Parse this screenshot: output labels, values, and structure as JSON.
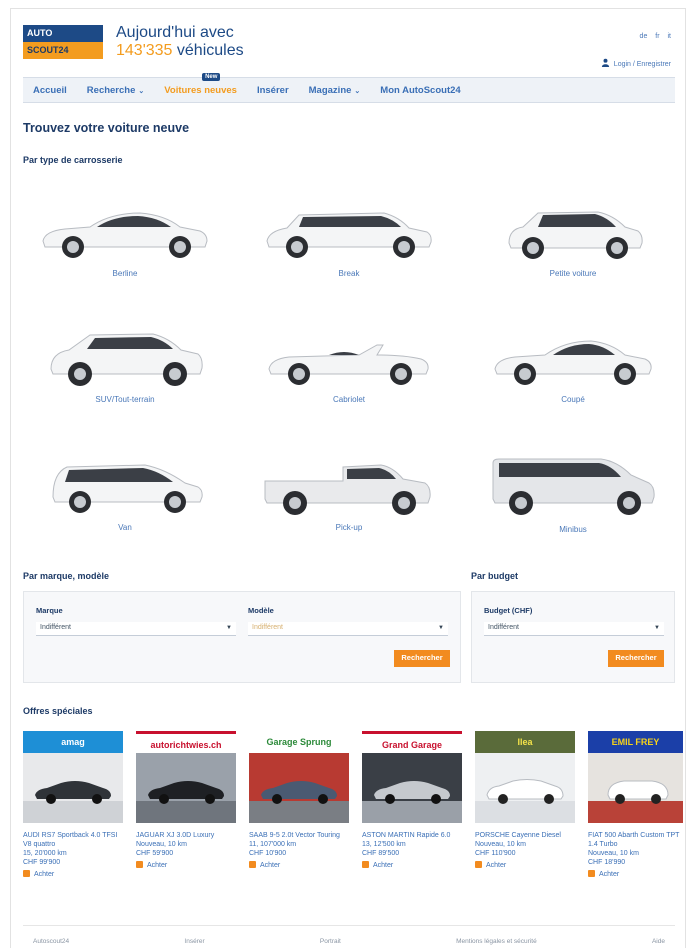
{
  "header": {
    "logo_top": "AUTO",
    "logo_bottom": "SCOUT24",
    "tagline_line1": "Aujourd'hui avec",
    "vehicle_count": "143'335",
    "vehicle_word": "véhicules",
    "languages": "de fr it",
    "login": "Login / Enregistrer"
  },
  "nav": {
    "items": [
      {
        "label": "Accueil"
      },
      {
        "label": "Recherche"
      },
      {
        "label": "Voitures neuves",
        "badge": "New"
      },
      {
        "label": "Insérer"
      },
      {
        "label": "Magazine"
      },
      {
        "label": "Mon AutoScout24"
      }
    ]
  },
  "page_title": "Trouvez votre voiture neuve",
  "body_types": {
    "title": "Par type de carrosserie",
    "items": [
      {
        "label": "Berline"
      },
      {
        "label": "Break"
      },
      {
        "label": "Petite voiture"
      },
      {
        "label": "SUV/Tout-terrain"
      },
      {
        "label": "Cabriolet"
      },
      {
        "label": "Coupé"
      },
      {
        "label": "Van"
      },
      {
        "label": "Pick-up"
      },
      {
        "label": "Minibus"
      }
    ]
  },
  "make_model": {
    "title": "Par marque, modèle",
    "make_label": "Marque",
    "make_value": "Indifférent",
    "model_label": "Modèle",
    "model_value": "Indifférent",
    "button": "Rechercher"
  },
  "budget": {
    "title": "Par budget",
    "label": "Budget (CHF)",
    "value": "Indifférent",
    "button": "Rechercher"
  },
  "offers": {
    "title": "Offres spéciales",
    "items": [
      {
        "brand": "amag",
        "text": "AUDI RS7 Sportback 4.0 TFSI V8 quattro",
        "line2": "15, 20'000 km",
        "line3": "CHF 99'900",
        "action": "Achter"
      },
      {
        "brand": "autorichtwies.ch",
        "text": "JAGUAR XJ 3.0D Luxury",
        "line2": "Nouveau, 10 km",
        "line3": "CHF 59'900",
        "action": "Achter"
      },
      {
        "brand": "Garage Sprung",
        "text": "SAAB 9-5 2.0t Vector Touring",
        "line2": "11, 107'000 km",
        "line3": "CHF 10'900",
        "action": "Achter"
      },
      {
        "brand": "Grand Garage",
        "text": "ASTON MARTIN Rapide 6.0",
        "line2": "13, 12'500 km",
        "line3": "CHF 89'500",
        "action": "Achter"
      },
      {
        "brand": "Ilea",
        "text": "PORSCHE Cayenne Diesel",
        "line2": "Nouveau, 10 km",
        "line3": "CHF 110'900",
        "action": "Achter"
      },
      {
        "brand": "EMIL FREY",
        "text": "FIAT 500 Abarth Custom TPT 1.4 Turbo",
        "line2": "Nouveau, 10 km",
        "line3": "CHF 18'990",
        "action": "Achter"
      }
    ]
  },
  "footer": {
    "links": [
      "Autoscout24",
      "Insérer",
      "Portrait",
      "Mentions légales et sécurité",
      "Aide"
    ]
  },
  "colors": {
    "brand_blue": "#1d4a86",
    "accent_orange": "#f39c1f",
    "link_blue": "#3a6fb6"
  }
}
